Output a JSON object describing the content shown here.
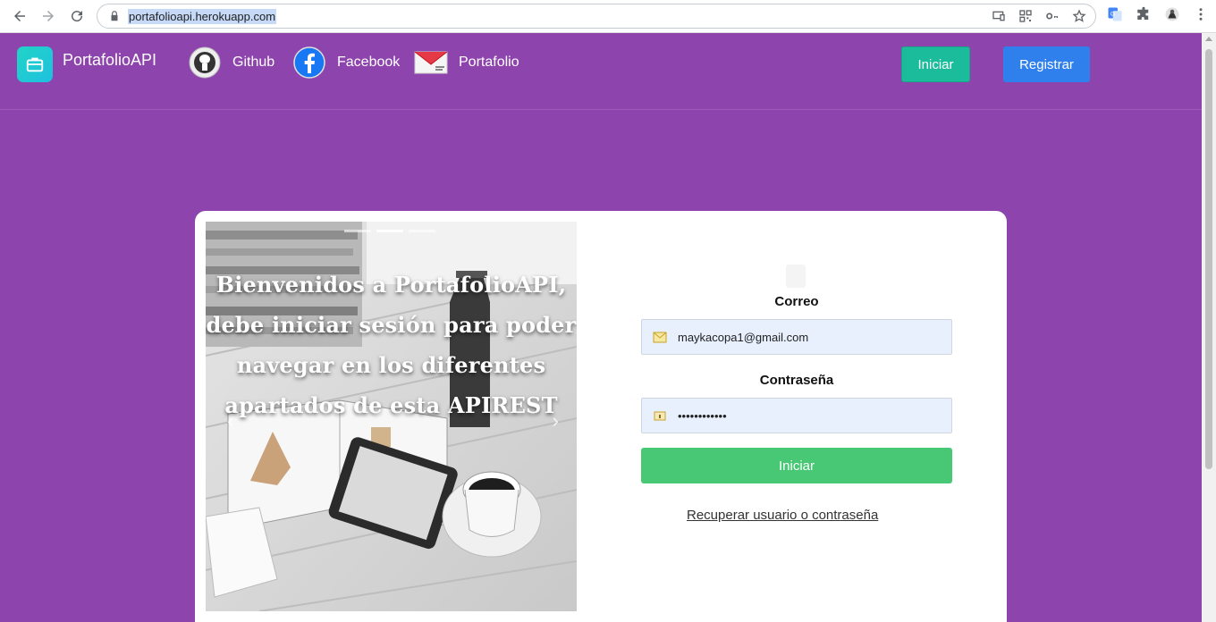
{
  "browser": {
    "url": "portafolioapi.herokuapp.com"
  },
  "navbar": {
    "brand": "PortafolioAPI",
    "links": [
      {
        "label": "Github",
        "icon": "github-icon"
      },
      {
        "label": "Facebook",
        "icon": "facebook-icon"
      },
      {
        "label": "Portafolio",
        "icon": "mail-icon"
      }
    ],
    "login_label": "Iniciar",
    "register_label": "Registrar"
  },
  "carousel": {
    "caption": "Bienvenidos a PortafolioAPI, debe iniciar sesión para poder navegar en los diferentes apartados de esta APIREST",
    "slides": 3,
    "active_slide": 2
  },
  "login_form": {
    "email_label": "Correo",
    "email_value": "maykacopa1@gmail.com",
    "password_label": "Contraseña",
    "password_value": "••••••••••••",
    "submit_label": "Iniciar",
    "recover_label": "Recuperar usuario o contraseña"
  },
  "colors": {
    "background": "#8e44ad",
    "teal_button": "#1abc9c",
    "blue_button": "#2f80ed",
    "green_button": "#48c774"
  }
}
